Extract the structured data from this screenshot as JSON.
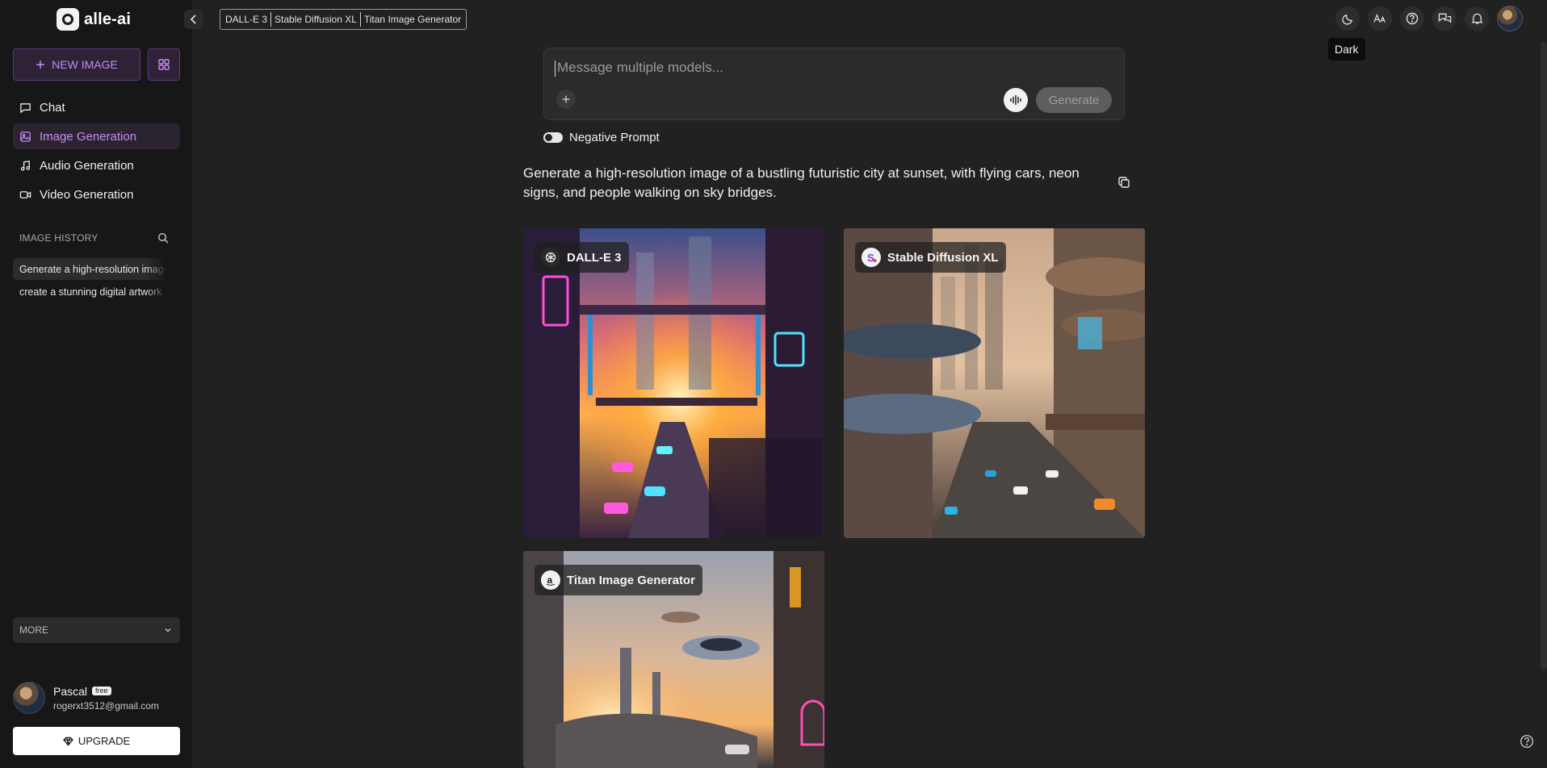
{
  "app": {
    "name": "alle-ai"
  },
  "sidebar": {
    "new_image_label": "NEW IMAGE",
    "nav": [
      {
        "label": "Chat",
        "icon": "chat-icon"
      },
      {
        "label": "Image Generation",
        "icon": "image-icon"
      },
      {
        "label": "Audio Generation",
        "icon": "music-icon"
      },
      {
        "label": "Video Generation",
        "icon": "video-icon"
      }
    ],
    "history_title": "IMAGE HISTORY",
    "history": [
      "Generate a high-resolution image of a bustling futuristic city at sunset, with flying cars, neon signs, and people walking on sky bridges.",
      "create a stunning digital artwork"
    ],
    "more_label": "MORE",
    "user": {
      "name": "Pascal",
      "plan": "free",
      "email": "rogerxt3512@gmail.com"
    },
    "upgrade_label": "UPGRADE"
  },
  "header": {
    "models": [
      "DALL-E 3",
      "Stable Diffusion XL",
      "Titan Image Generator"
    ],
    "tooltip": "Dark"
  },
  "composer": {
    "placeholder": "Message multiple models...",
    "generate_label": "Generate",
    "negative_prompt_label": "Negative Prompt"
  },
  "prompt": "Generate a high-resolution image of a bustling futuristic city at sunset, with flying cars, neon signs, and people walking on sky bridges.",
  "results": [
    {
      "model": "DALL-E 3",
      "icon": "openai-logo-icon"
    },
    {
      "model": "Stable Diffusion XL",
      "icon": "stability-logo-icon"
    },
    {
      "model": "Titan Image Generator",
      "icon": "amazon-logo-icon"
    }
  ],
  "colors": {
    "accent": "#c58cf5",
    "background": "#212121",
    "sidebar": "#171717"
  }
}
